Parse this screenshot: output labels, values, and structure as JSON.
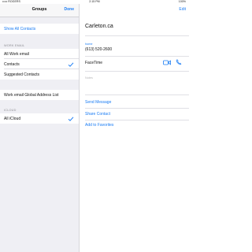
{
  "status": {
    "carrier": "••••• ROGERS",
    "time": "2:15 PM",
    "battery": "100%"
  },
  "groups_pane": {
    "title": "Groups",
    "done_label": "Done",
    "show_all": "Show All Contacts",
    "sections": [
      {
        "header": "WORK EMAIL",
        "items": [
          {
            "label": "All Work email",
            "checked": false
          },
          {
            "label": "Contacts",
            "checked": true
          },
          {
            "label": "Suggested Contacts",
            "checked": false
          }
        ]
      },
      {
        "header": "",
        "items": [
          {
            "label": "Work email Global Address List",
            "checked": false
          }
        ]
      },
      {
        "header": "ICLOUD",
        "items": [
          {
            "label": "All iCloud",
            "checked": true
          }
        ]
      }
    ]
  },
  "contact": {
    "edit_label": "Edit",
    "name": "Carleton.ca",
    "phone_label": "home",
    "phone_value": "(613) 520-2600",
    "facetime_label": "FaceTime",
    "notes_label": "Notes",
    "actions": [
      "Send Message",
      "Share Contact",
      "Add to Favorites"
    ]
  },
  "colors": {
    "accent": "#1a7cf4",
    "pane_bg": "#efeff4"
  }
}
